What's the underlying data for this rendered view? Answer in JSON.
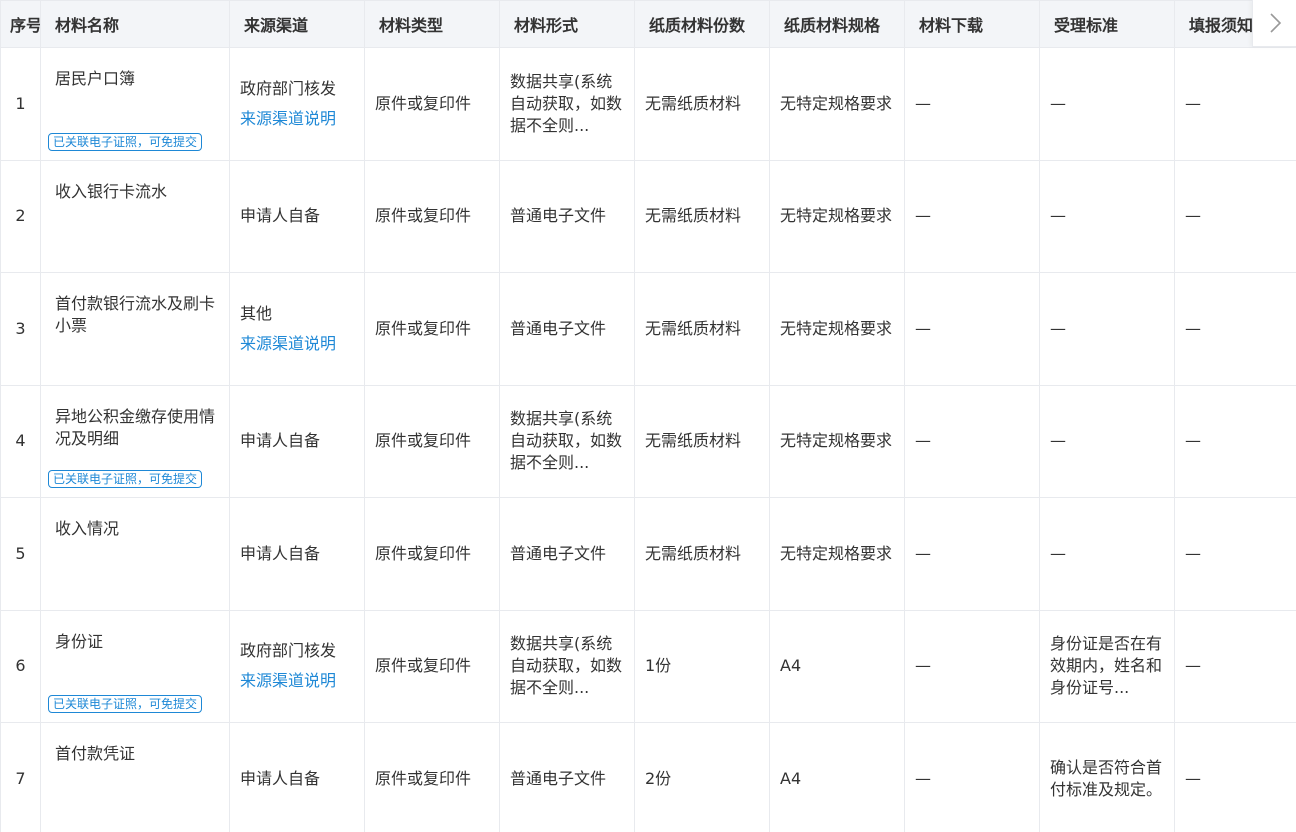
{
  "headers": [
    "序号",
    "材料名称",
    "来源渠道",
    "材料类型",
    "材料形式",
    "纸质材料份数",
    "纸质材料规格",
    "材料下载",
    "受理标准",
    "填报须知"
  ],
  "badge_text": "已关联电子证照，可免提交",
  "source_link_text": "来源渠道说明",
  "scroll_icon": "chevron-right-icon",
  "colors": {
    "link": "#1e88d6",
    "header_bg": "#f3f5f8",
    "border": "#e8eaee"
  },
  "rows": [
    {
      "index": "1",
      "name": "居民户口簿",
      "badge": true,
      "source": "政府部门核发",
      "source_link": true,
      "type": "原件或复印件",
      "form": "数据共享(系统自动获取，如数据不全则...",
      "copies": "无需纸质材料",
      "spec": "无特定规格要求",
      "download": "—",
      "standard": "—",
      "notes": "—"
    },
    {
      "index": "2",
      "name": "收入银行卡流水",
      "badge": false,
      "source": "申请人自备",
      "source_link": false,
      "type": "原件或复印件",
      "form": "普通电子文件",
      "copies": "无需纸质材料",
      "spec": "无特定规格要求",
      "download": "—",
      "standard": "—",
      "notes": "—"
    },
    {
      "index": "3",
      "name": "首付款银行流水及刷卡小票",
      "badge": false,
      "source": "其他",
      "source_link": true,
      "type": "原件或复印件",
      "form": "普通电子文件",
      "copies": "无需纸质材料",
      "spec": "无特定规格要求",
      "download": "—",
      "standard": "—",
      "notes": "—"
    },
    {
      "index": "4",
      "name": "异地公积金缴存使用情况及明细",
      "badge": true,
      "source": "申请人自备",
      "source_link": false,
      "type": "原件或复印件",
      "form": "数据共享(系统自动获取，如数据不全则...",
      "copies": "无需纸质材料",
      "spec": "无特定规格要求",
      "download": "—",
      "standard": "—",
      "notes": "—"
    },
    {
      "index": "5",
      "name": "收入情况",
      "badge": false,
      "source": "申请人自备",
      "source_link": false,
      "type": "原件或复印件",
      "form": "普通电子文件",
      "copies": "无需纸质材料",
      "spec": "无特定规格要求",
      "download": "—",
      "standard": "—",
      "notes": "—"
    },
    {
      "index": "6",
      "name": "身份证",
      "badge": true,
      "source": "政府部门核发",
      "source_link": true,
      "type": "原件或复印件",
      "form": "数据共享(系统自动获取，如数据不全则...",
      "copies": "1份",
      "spec": "A4",
      "download": "—",
      "standard": "身份证是否在有效期内，姓名和身份证号...",
      "notes": "—"
    },
    {
      "index": "7",
      "name": "首付款凭证",
      "badge": false,
      "source": "申请人自备",
      "source_link": false,
      "type": "原件或复印件",
      "form": "普通电子文件",
      "copies": "2份",
      "spec": "A4",
      "download": "—",
      "standard": "确认是否符合首付标准及规定。",
      "notes": "—"
    }
  ]
}
